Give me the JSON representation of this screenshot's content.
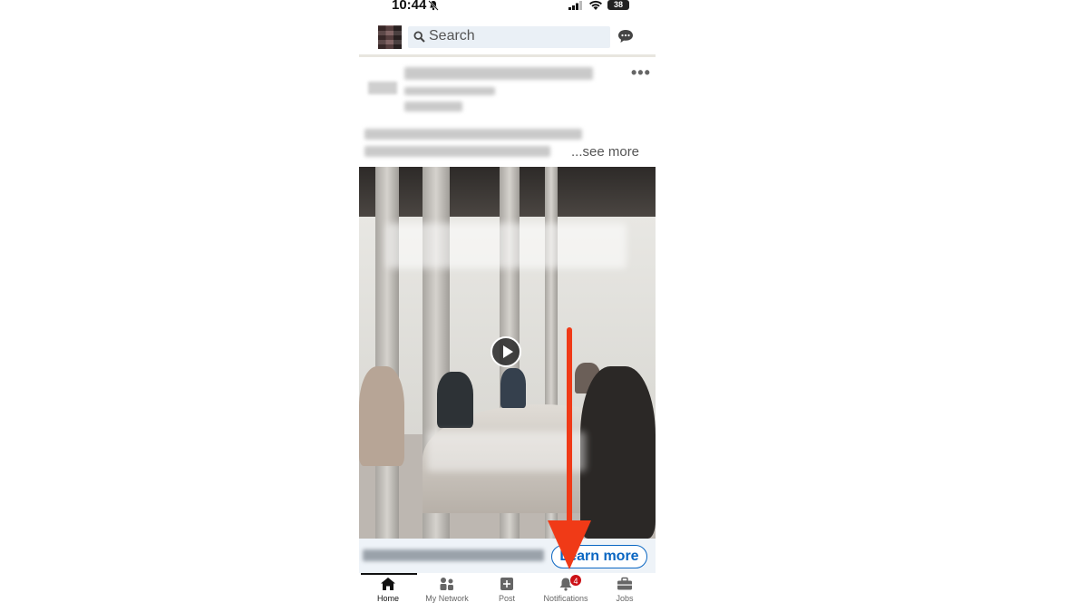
{
  "status_bar": {
    "time": "10:44",
    "battery": "38",
    "icons": [
      "bell-slash-icon",
      "signal-icon",
      "wifi-icon",
      "battery-icon"
    ]
  },
  "top_nav": {
    "search_placeholder": "Search",
    "icons": [
      "avatar",
      "search-icon",
      "messaging-icon"
    ]
  },
  "post": {
    "see_more": "...see more",
    "more_menu": "•••"
  },
  "video": {
    "play_icon": "play-icon"
  },
  "cta": {
    "button_label": "Learn more"
  },
  "bottom_nav": {
    "items": [
      {
        "label": "Home",
        "icon": "home-icon",
        "active": true
      },
      {
        "label": "My Network",
        "icon": "network-icon",
        "active": false
      },
      {
        "label": "Post",
        "icon": "post-icon",
        "active": false
      },
      {
        "label": "Notifications",
        "icon": "bell-icon",
        "active": false,
        "badge": "4"
      },
      {
        "label": "Jobs",
        "icon": "briefcase-icon",
        "active": false
      }
    ]
  },
  "colors": {
    "accent_blue": "#0a66c2",
    "badge_red": "#cc1016",
    "annotation_red": "#f03a17"
  }
}
